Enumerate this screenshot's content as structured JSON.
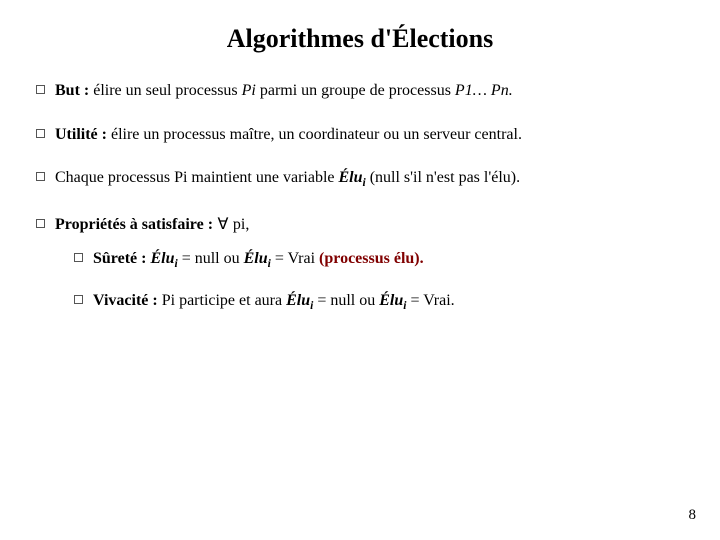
{
  "title": "Algorithmes d'Élections",
  "bullets": {
    "but_label": "But :",
    "but_text1": " élire un seul processus ",
    "but_pi": "Pi",
    "but_text2": " parmi un groupe de processus ",
    "but_range": "P1… Pn.",
    "utilite_label": "Utilité :",
    "utilite_text": " élire un processus maître, un coordinateur ou un serveur central.",
    "variable_text1": "Chaque processus Pi maintient une variable ",
    "elu": "Élu",
    "sub_i": "i",
    "variable_text2": " (null s'il n'est pas l'élu).",
    "props_label": "Propriétés à satisfaire :",
    "forall": " ∀ ",
    "pi_low": "pi,",
    "surete_label": "Sûreté :",
    "surete_mid1": " = null ou ",
    "surete_mid2": " = Vrai ",
    "surete_end": "(processus élu).",
    "viva_label": "Vivacité :",
    "viva_text1": " Pi participe et aura ",
    "viva_mid1": " = null ou ",
    "viva_mid2": " = Vrai."
  },
  "page_number": "8"
}
